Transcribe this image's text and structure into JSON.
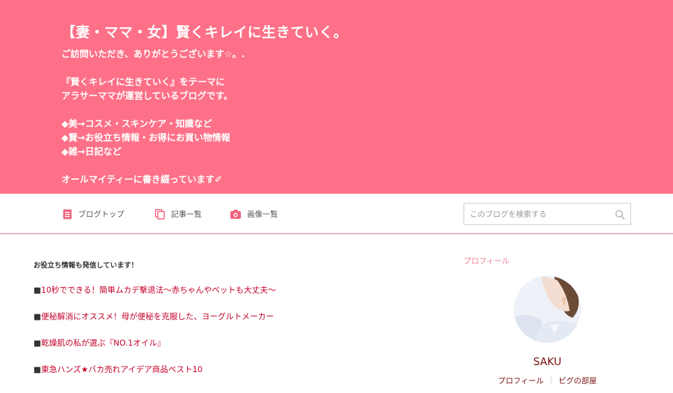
{
  "header": {
    "title": "【妻・ママ・女】賢くキレイに生きていく。",
    "description_lines": [
      "ご訪問いただき、ありがとうございます☆。.",
      "",
      "『賢くキレイに生きていく』をテーマに",
      "アラサーママが運営しているブログです。",
      "",
      "◆美→コスメ・スキンケア・知識など",
      "◆賢→お役立ち情報・お得にお買い物情報",
      "◆雑→日記など",
      "",
      "オールマイティーに書き綴っています✐"
    ],
    "background": "#fd7087"
  },
  "nav": {
    "items": [
      {
        "label": "ブログトップ",
        "icon": "document-icon"
      },
      {
        "label": "記事一覧",
        "icon": "copy-icon"
      },
      {
        "label": "画像一覧",
        "icon": "camera-icon"
      }
    ],
    "icon_color": "#f0637c",
    "search": {
      "placeholder": "このブログを検索する",
      "icon": "search-icon"
    }
  },
  "main": {
    "section_title": "お役立ち情報も発信しています！",
    "bullet": "■",
    "links": [
      "10秒でできる！簡単ムカデ撃退法〜赤ちゃんやペットも大丈夫〜",
      "便秘解消にオススメ！母が便秘を克服した、ヨーグルトメーカー",
      "乾燥肌の私が選ぶ『NO.1オイル』",
      "東急ハンズ★バカ売れアイデア商品ベスト10"
    ],
    "link_color": "#c5002a"
  },
  "sidebar": {
    "heading": "プロフィール",
    "username": "SAKU",
    "profile_link": "プロフィール",
    "pigg_link": "ピグの部屋"
  }
}
